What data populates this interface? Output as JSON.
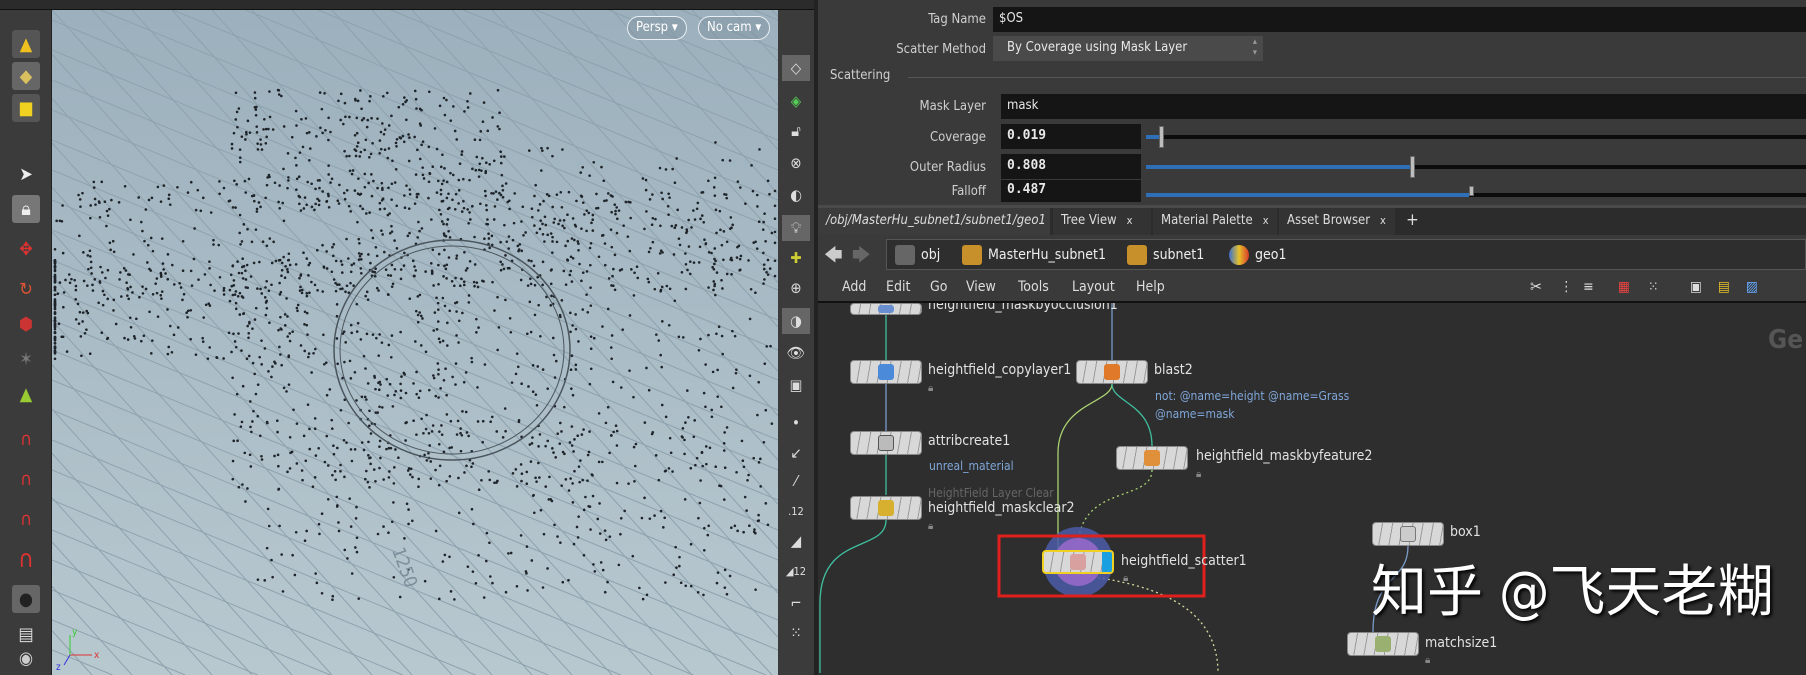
{
  "viewport": {
    "persp_label": "Persp",
    "cam_label": "No cam",
    "grid_labels": [
      "1250"
    ],
    "axis_labels": {
      "x": "x",
      "y": "y",
      "z": "z"
    }
  },
  "params": {
    "tag_name": {
      "label": "Tag Name",
      "value": "$OS"
    },
    "scatter_method": {
      "label": "Scatter Method",
      "value": "By Coverage using Mask Layer"
    },
    "section": "Scattering",
    "mask_layer": {
      "label": "Mask Layer",
      "value": "mask"
    },
    "coverage": {
      "label": "Coverage",
      "value": "0.019",
      "fraction": 0.019
    },
    "outer_radius": {
      "label": "Outer Radius",
      "value": "0.808",
      "fraction": 0.4
    },
    "falloff": {
      "label": "Falloff",
      "value": "0.487",
      "fraction": 0.49
    }
  },
  "tabs": [
    {
      "label": "/obj/MasterHu_subnet1/subnet1/geo1",
      "close": "x"
    },
    {
      "label": "Tree View",
      "close": "x"
    },
    {
      "label": "Material Palette",
      "close": "x"
    },
    {
      "label": "Asset Browser",
      "close": "x"
    }
  ],
  "add_tab": "+",
  "breadcrumb": [
    "obj",
    "MasterHu_subnet1",
    "subnet1",
    "geo1"
  ],
  "menu": [
    "Add",
    "Edit",
    "Go",
    "View",
    "Tools",
    "Layout",
    "Help"
  ],
  "network": {
    "context_label": "Ge",
    "nodes": {
      "maskbyocclusion": "heightfield_maskbyocclusion1",
      "copylayer": "heightfield_copylayer1",
      "blast": "blast2",
      "blast_comment_1": "not: @name=height @name=Grass",
      "blast_comment_2": "@name=mask",
      "attribcreate": "attribcreate1",
      "attribcreate_comment": "unreal_material",
      "maskbyfeature": "heightfield_maskbyfeature2",
      "maskclear_comment": "HeightField Layer Clear",
      "maskclear": "heightfield_maskclear2",
      "scatter": "heightfield_scatter1",
      "box": "box1",
      "matchsize": "matchsize1"
    },
    "highlight_color": "#e0201c",
    "wire_color": "#3fbf9f"
  },
  "watermark": "知乎 @飞天老糊"
}
